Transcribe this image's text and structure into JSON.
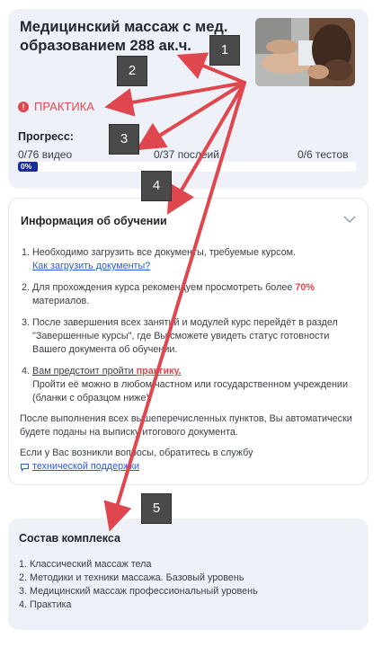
{
  "course": {
    "title": "Медицинский массаж с мед. образованием 288 ак.ч.",
    "thumbnail_icon": "massage-photo",
    "status_label": "ПРАКТИКА",
    "status_icon": "info-icon",
    "progress_heading": "Прогресс:",
    "videos": "0/76 видео",
    "lessons": "0/37 послеий",
    "tests": "0/6 тестов",
    "progress_percent_label": "0%",
    "progress_fraction": 0
  },
  "info": {
    "title": "Информация об обучении",
    "items": [
      {
        "num": "1.",
        "text": "Необходимо загрузить все документы, требуемые курсом.",
        "link": "Как загрузить документы?"
      },
      {
        "num": "2.",
        "text_before": "Для прохождения курса рекомендуем просмотреть более ",
        "accent": "70%",
        "text_after": " материалов."
      },
      {
        "num": "3.",
        "text": "После завершения всех занятий и модулей курс перейдёт в раздел \"Завершенные курсы\", где Вы сможете увидеть статус готовности Вашего документа об обучении."
      },
      {
        "num": "4.",
        "link_before": "Вам предстоит пройти ",
        "link_accent": "практику.",
        "text": "Пройти её можно в любом частном или государственном учреждении (бланки с образцом ниже)."
      }
    ],
    "paragraph_after": "После выполнения всех вышеперечисленных пунктов, Вы автоматически будете поданы на выписку итогового документа.",
    "paragraph_contact": "Если у Вас возникли вопросы, обратитесь в службу",
    "support_link": "технической поддержки"
  },
  "composition": {
    "title": "Состав комплекса",
    "items": [
      "1. Классический массаж тела",
      "2. Методики и техники массажа. Базовый уровень",
      "3. Медицинский массаж профессиональный уровень",
      "4. Практика"
    ]
  },
  "annotations": {
    "labels": [
      "1",
      "2",
      "3",
      "4",
      "5"
    ],
    "color": "#e0464e"
  },
  "colors": {
    "accent_red": "#e0464e",
    "link_blue": "#2a5bd7",
    "progress_navy": "#1a2b9c",
    "card_bg": "#eef1f7"
  }
}
